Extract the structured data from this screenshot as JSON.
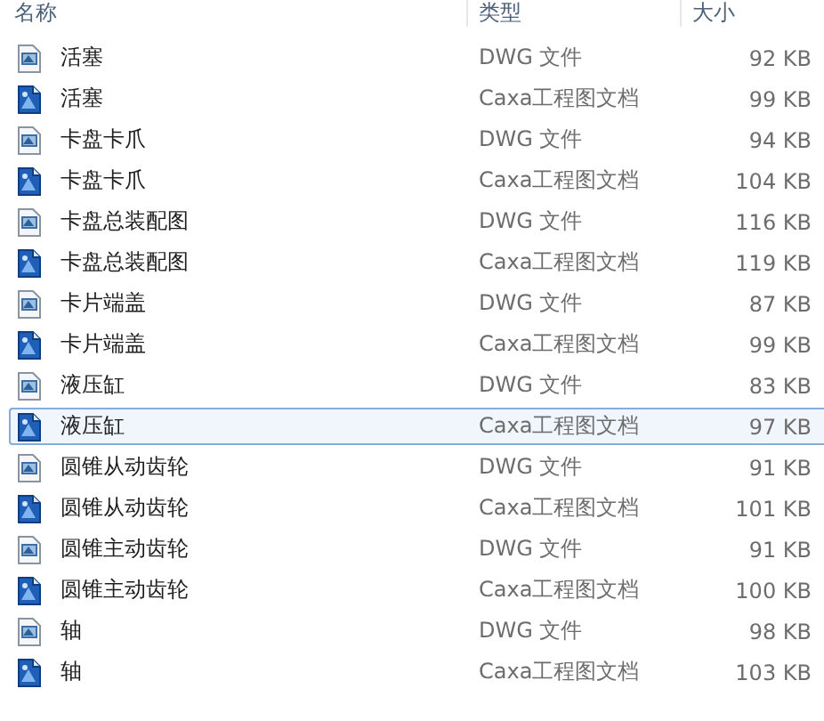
{
  "columns": [
    {
      "label": "名称"
    },
    {
      "label": "类型"
    },
    {
      "label": "大小"
    }
  ],
  "files": [
    {
      "name": "活塞",
      "type": "DWG 文件",
      "size": "92 KB",
      "kind": "dwg",
      "selected": false
    },
    {
      "name": "活塞",
      "type": "Caxa工程图文档",
      "size": "99 KB",
      "kind": "caxa",
      "selected": false
    },
    {
      "name": "卡盘卡爪",
      "type": "DWG 文件",
      "size": "94 KB",
      "kind": "dwg",
      "selected": false
    },
    {
      "name": "卡盘卡爪",
      "type": "Caxa工程图文档",
      "size": "104 KB",
      "kind": "caxa",
      "selected": false
    },
    {
      "name": "卡盘总装配图",
      "type": "DWG 文件",
      "size": "116 KB",
      "kind": "dwg",
      "selected": false
    },
    {
      "name": "卡盘总装配图",
      "type": "Caxa工程图文档",
      "size": "119 KB",
      "kind": "caxa",
      "selected": false
    },
    {
      "name": "卡片端盖",
      "type": "DWG 文件",
      "size": "87 KB",
      "kind": "dwg",
      "selected": false
    },
    {
      "name": "卡片端盖",
      "type": "Caxa工程图文档",
      "size": "99 KB",
      "kind": "caxa",
      "selected": false
    },
    {
      "name": "液压缸",
      "type": "DWG 文件",
      "size": "83 KB",
      "kind": "dwg",
      "selected": false
    },
    {
      "name": "液压缸",
      "type": "Caxa工程图文档",
      "size": "97 KB",
      "kind": "caxa",
      "selected": true
    },
    {
      "name": "圆锥从动齿轮",
      "type": "DWG 文件",
      "size": "91 KB",
      "kind": "dwg",
      "selected": false
    },
    {
      "name": "圆锥从动齿轮",
      "type": "Caxa工程图文档",
      "size": "101 KB",
      "kind": "caxa",
      "selected": false
    },
    {
      "name": "圆锥主动齿轮",
      "type": "DWG 文件",
      "size": "91 KB",
      "kind": "dwg",
      "selected": false
    },
    {
      "name": "圆锥主动齿轮",
      "type": "Caxa工程图文档",
      "size": "100 KB",
      "kind": "caxa",
      "selected": false
    },
    {
      "name": "轴",
      "type": "DWG 文件",
      "size": "98 KB",
      "kind": "dwg",
      "selected": false
    },
    {
      "name": "轴",
      "type": "Caxa工程图文档",
      "size": "103 KB",
      "kind": "caxa",
      "selected": false
    }
  ]
}
